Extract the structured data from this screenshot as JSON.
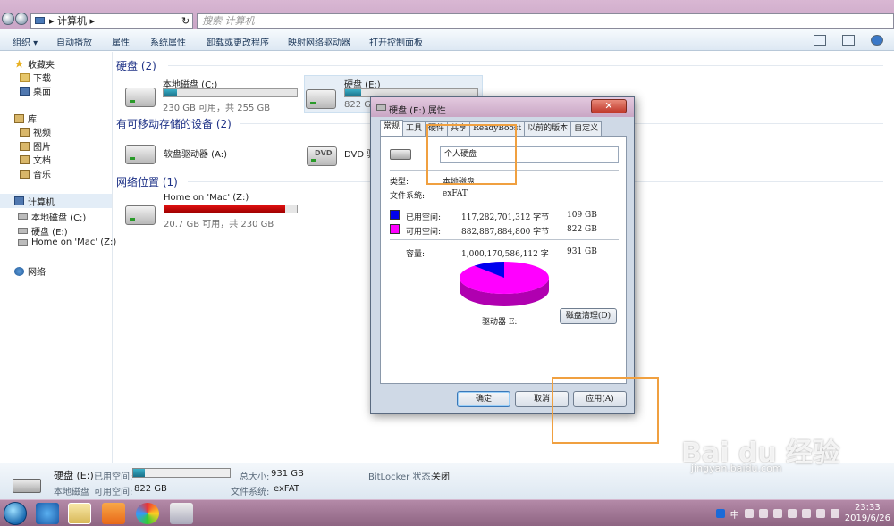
{
  "address": {
    "path": "计算机",
    "separator": "▸",
    "search_placeholder": "搜索 计算机",
    "refresh": "↻"
  },
  "toolbar": {
    "organize": "组织 ▾",
    "autoplay": "自动播放",
    "properties": "属性",
    "system_properties": "系统属性",
    "uninstall": "卸载或更改程序",
    "map_drive": "映射网络驱动器",
    "control_panel": "打开控制面板"
  },
  "sidebar": {
    "favorites": "收藏夹",
    "downloads": "下载",
    "desktop": "桌面",
    "library": "库",
    "videos": "视频",
    "pictures": "图片",
    "documents": "文档",
    "music": "音乐",
    "computer": "计算机",
    "local_c": "本地磁盘 (C:)",
    "disk_e": "硬盘 (E:)",
    "mac_z": "Home on 'Mac' (Z:)",
    "network": "网络"
  },
  "main": {
    "hdd_group": "硬盘 (2)",
    "removable_group": "有可移动存储的设备 (2)",
    "network_group": "网络位置 (1)",
    "drives": [
      {
        "name": "本地磁盘 (C:)",
        "free_text": "230 GB 可用，共 255 GB",
        "used_fraction": 0.1
      },
      {
        "name": "硬盘 (E:)",
        "free_text": "822 GB",
        "used_fraction": 0.12
      },
      {
        "name": "Home on 'Mac' (Z:)",
        "free_text": "20.7 GB 可用，共 230 GB",
        "used_fraction": 0.91
      }
    ],
    "floppy": "软盘驱动器 (A:)",
    "dvd": "DVD 驱",
    "dvd_badge": "DVD"
  },
  "dialog": {
    "title": "硬盘 (E:) 属性",
    "close": "✕",
    "tabs": [
      "常规",
      "工具",
      "硬件",
      "共享",
      "ReadyBoost",
      "以前的版本",
      "自定义"
    ],
    "volume_name": "个人硬盘",
    "type_label": "类型:",
    "type_value": "本地磁盘",
    "fs_label": "文件系统:",
    "fs_value": "exFAT",
    "used_label": "已用空间:",
    "used_bytes": "117,282,701,312 字节",
    "used_gb": "109 GB",
    "free_label": "可用空间:",
    "free_bytes": "882,887,884,800 字节",
    "free_gb": "822 GB",
    "capacity_label": "容量:",
    "capacity_bytes": "1,000,170,586,112 字",
    "capacity_gb": "931 GB",
    "drive_label": "驱动器 E:",
    "cleanup": "磁盘清理(D)",
    "ok": "确定",
    "cancel": "取消",
    "apply": "应用(A)",
    "used_color": "#0000ee",
    "free_color": "#ff00ff",
    "used_fraction": 0.117
  },
  "status": {
    "drive_name": "硬盘 (E:)",
    "used_label": "已用空间:",
    "type": "本地磁盘",
    "free_label": "可用空间:",
    "free_value": "822 GB",
    "total_label": "总大小:",
    "total_value": "931 GB",
    "fs_label": "文件系统:",
    "fs_value": "exFAT",
    "bitlocker_label": "BitLocker 状态:",
    "bitlocker_value": "关闭",
    "used_fraction": 0.117
  },
  "taskbar": {
    "time": "23:33",
    "date": "2019/6/26",
    "ime": "中"
  },
  "watermark": {
    "brand": "Bai du 经验",
    "url": "jingyan.baidu.com"
  }
}
